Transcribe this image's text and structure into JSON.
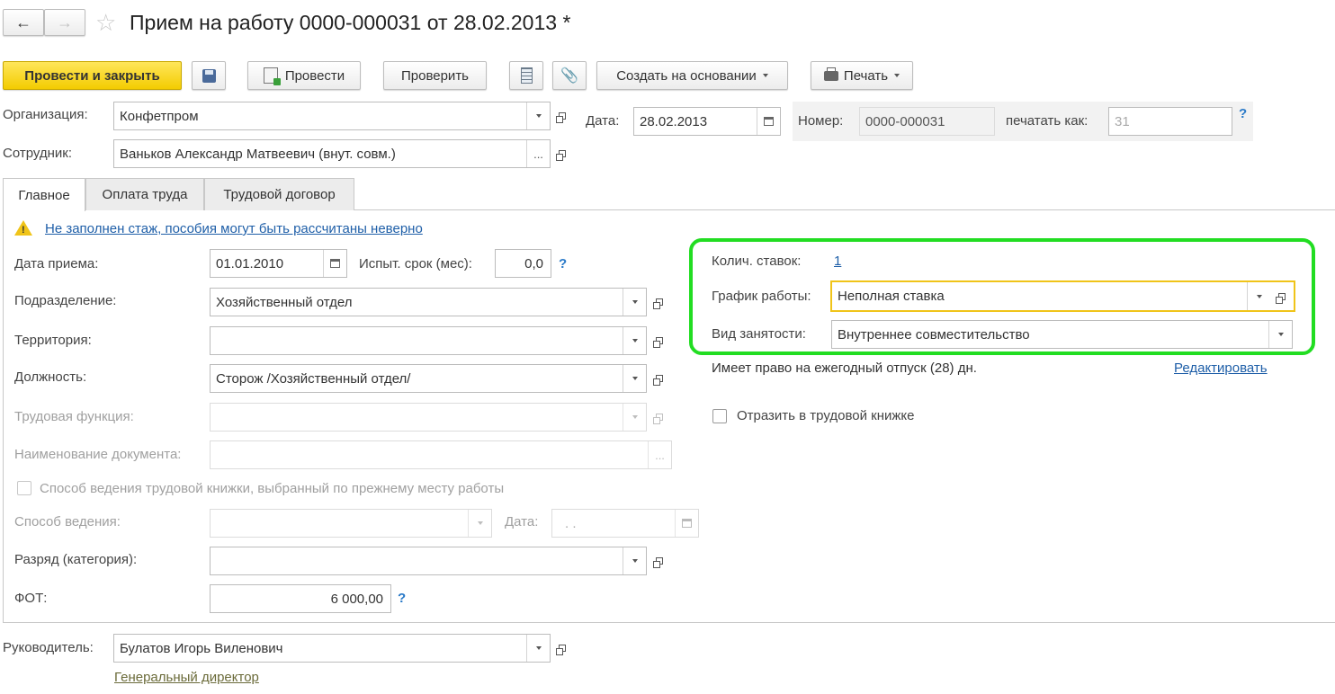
{
  "window": {
    "title": "Прием на работу 0000-000031 от 28.02.2013 *"
  },
  "toolbar": {
    "post_close": "Провести и закрыть",
    "post": "Провести",
    "check": "Проверить",
    "create_based": "Создать на основании",
    "print": "Печать"
  },
  "header": {
    "org_label": "Организация:",
    "org_value": "Конфетпром",
    "date_label": "Дата:",
    "date_value": "28.02.2013",
    "number_label": "Номер:",
    "number_value": "0000-000031",
    "print_as_label": "печатать как:",
    "print_as_value": "31",
    "employee_label": "Сотрудник:",
    "employee_value": "Ваньков Александр Матвеевич (внут. совм.)"
  },
  "tabs": [
    "Главное",
    "Оплата труда",
    "Трудовой договор"
  ],
  "main": {
    "warning": "Не заполнен стаж, пособия могут быть рассчитаны неверно",
    "hire_date_label": "Дата приема:",
    "hire_date_value": "01.01.2010",
    "probation_label": "Испыт. срок (мес):",
    "probation_value": "0,0",
    "department_label": "Подразделение:",
    "department_value": "Хозяйственный отдел",
    "territory_label": "Территория:",
    "territory_value": "",
    "position_label": "Должность:",
    "position_value": "Сторож /Хозяйственный отдел/",
    "labor_function_label": "Трудовая функция:",
    "doc_name_label": "Наименование документа:",
    "workbook_checkbox_label": "Способ ведения трудовой книжки, выбранный по прежнему месту работы",
    "method_label": "Способ ведения:",
    "method_date_label": "Дата:",
    "method_date_value": ".  .",
    "grade_label": "Разряд (категория):",
    "fot_label": "ФОТ:",
    "fot_value": "6 000,00"
  },
  "right": {
    "rates_label": "Колич. ставок:",
    "rates_value": "1",
    "schedule_label": "График работы:",
    "schedule_value": "Неполная ставка",
    "employment_label": "Вид занятости:",
    "employment_value": "Внутреннее совместительство",
    "vacation_text": "Имеет право на ежегодный отпуск (28) дн.",
    "edit_link": "Редактировать",
    "workbook_reflect_label": "Отразить в трудовой книжке"
  },
  "footer": {
    "manager_label": "Руководитель:",
    "manager_value": "Булатов Игорь Виленович",
    "manager_position": "Генеральный директор"
  },
  "colors": {
    "highlight_green": "#22dd22",
    "focus_yellow": "#f0c419",
    "primary_button": "#f5d000",
    "link_blue": "#1f5fa8"
  }
}
